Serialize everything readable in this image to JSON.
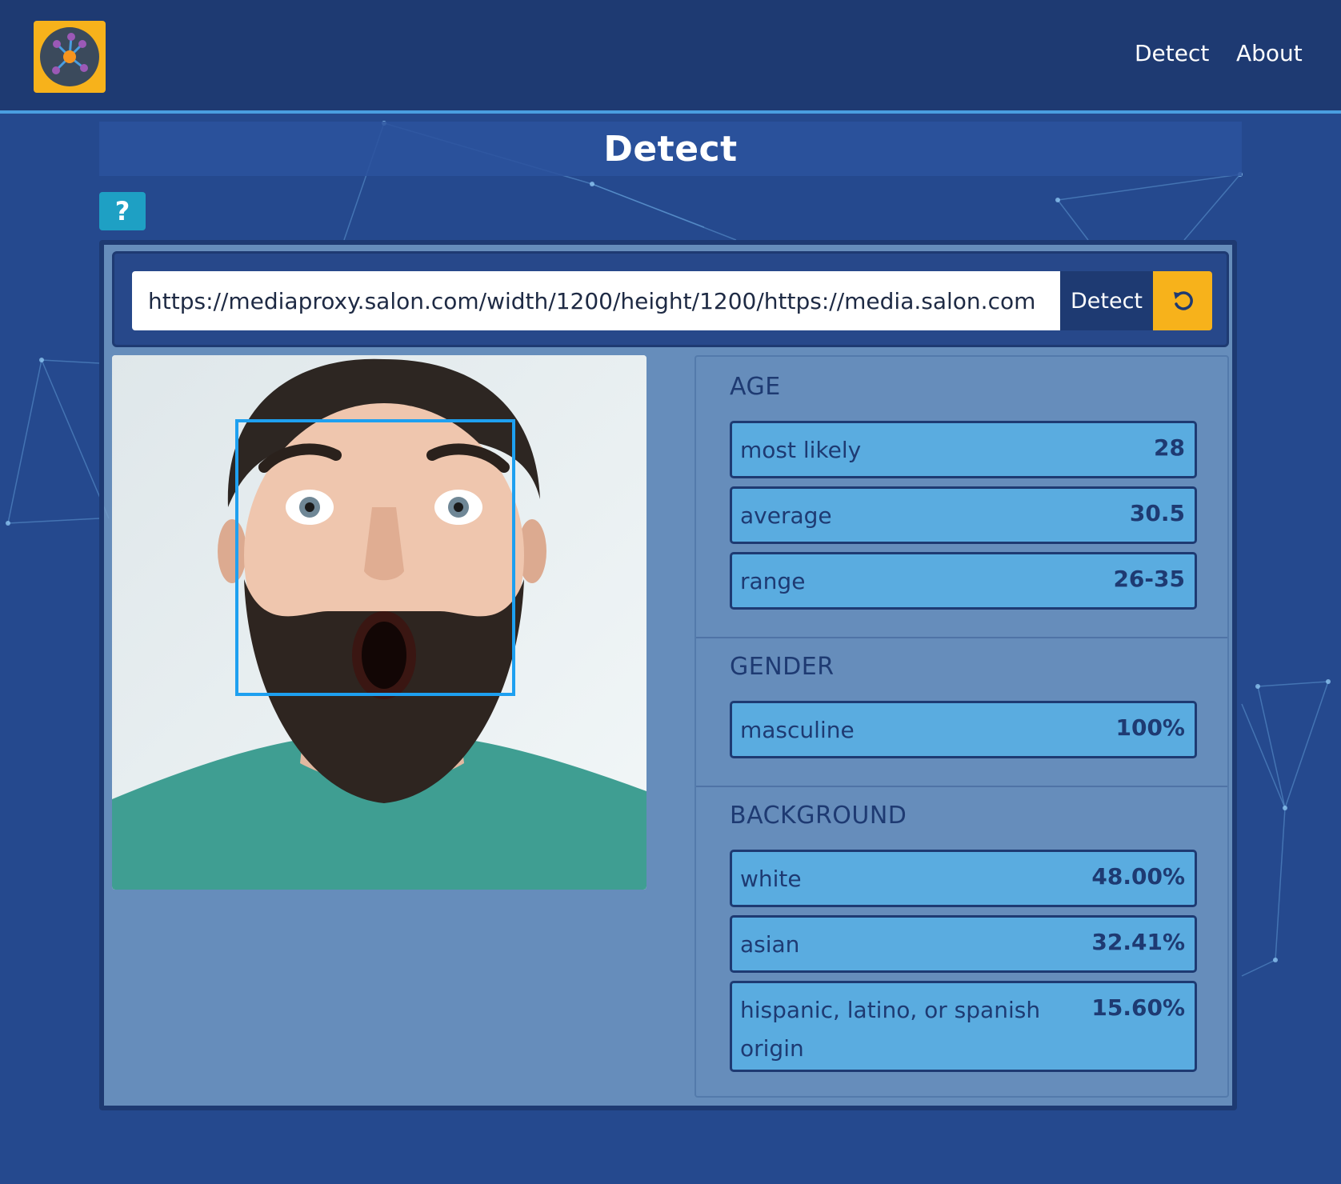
{
  "header": {
    "logo_alt": "network-logo",
    "nav": [
      {
        "label": "Detect"
      },
      {
        "label": "About"
      }
    ]
  },
  "page": {
    "title": "Detect",
    "help_label": "?"
  },
  "url_form": {
    "value": "https://mediaproxy.salon.com/width/1200/height/1200/https://media.salon.com",
    "detect_label": "Detect",
    "reset_icon": "refresh-icon"
  },
  "results": {
    "age": {
      "title": "AGE",
      "items": [
        {
          "label": "most likely",
          "value": "28"
        },
        {
          "label": "average",
          "value": "30.5"
        },
        {
          "label": "range",
          "value": "26-35"
        }
      ]
    },
    "gender": {
      "title": "GENDER",
      "items": [
        {
          "label": "masculine",
          "value": "100%"
        }
      ]
    },
    "background": {
      "title": "BACKGROUND",
      "items": [
        {
          "label": "white",
          "value": "48.00%"
        },
        {
          "label": "asian",
          "value": "32.41%"
        },
        {
          "label": "hispanic, latino, or spanish origin",
          "value": "15.60%"
        }
      ]
    }
  },
  "colors": {
    "navy": "#1e3a72",
    "accent_blue": "#4a9ee0",
    "yellow": "#f7b21b",
    "teal": "#1ea0c4",
    "stat_fill": "#5aace0"
  }
}
